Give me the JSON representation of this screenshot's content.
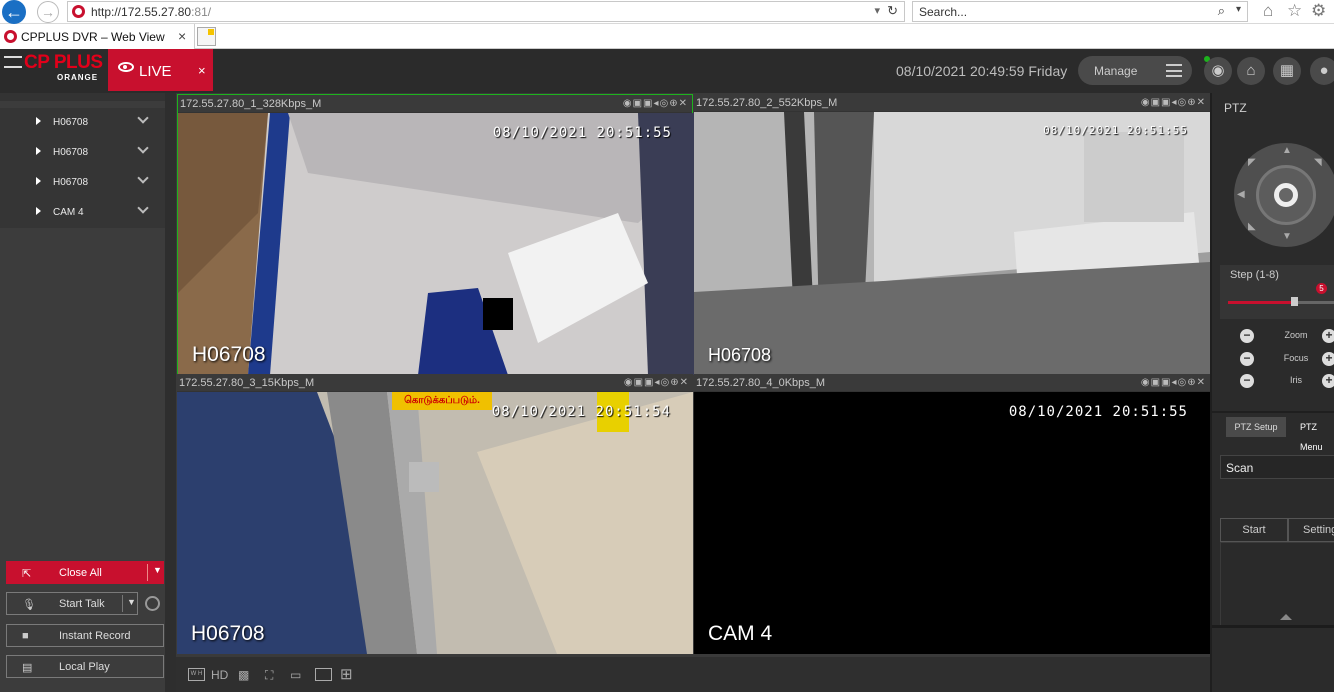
{
  "browser": {
    "url_main": "http://172.55.27.80",
    "url_port": ":81/",
    "search_placeholder": "Search...",
    "tab_title": "CPPLUS DVR – Web View"
  },
  "header": {
    "logo_text": "CP PLUS",
    "logo_sub": "ORANGE",
    "live_label": "LIVE",
    "live_close": "×",
    "datetime": "08/10/2021 20:49:59 Friday",
    "manage_label": "Manage"
  },
  "channels": [
    {
      "label": "H06708"
    },
    {
      "label": "H06708"
    },
    {
      "label": "H06708"
    },
    {
      "label": "CAM 4"
    }
  ],
  "left_buttons": {
    "close_all": "Close All",
    "start_talk": "Start Talk",
    "instant_record": "Instant Record",
    "local_play": "Local Play"
  },
  "cells": [
    {
      "title": "172.55.27.80_1_328Kbps_M",
      "osd_time": "08/10/2021  20:51:55",
      "osd_name": "H06708"
    },
    {
      "title": "172.55.27.80_2_552Kbps_M",
      "osd_time": "08/10/2021  20:51:55",
      "osd_name": "H06708"
    },
    {
      "title": "172.55.27.80_3_15Kbps_M",
      "osd_time": "08/10/2021  20:51:54",
      "osd_name": "H06708"
    },
    {
      "title": "172.55.27.80_4_0Kbps_M",
      "osd_time": "08/10/2021  20:51:55",
      "osd_name": "CAM 4"
    }
  ],
  "cell3_sign": "கொடுக்கப்படும்.",
  "bottom_bar": {
    "wh": "W H",
    "hd": "HD"
  },
  "ptz": {
    "title": "PTZ",
    "step_label": "Step (1-8)",
    "step_value": "5",
    "step_fraction": 0.6,
    "zoom": "Zoom",
    "focus": "Focus",
    "iris": "Iris",
    "tab_setup": "PTZ Setup",
    "tab_menu": "PTZ Menu",
    "scan": "Scan",
    "start": "Start",
    "setting": "Setting"
  },
  "colors": {
    "accent": "#c8102e",
    "active_border": "#1db31d"
  }
}
